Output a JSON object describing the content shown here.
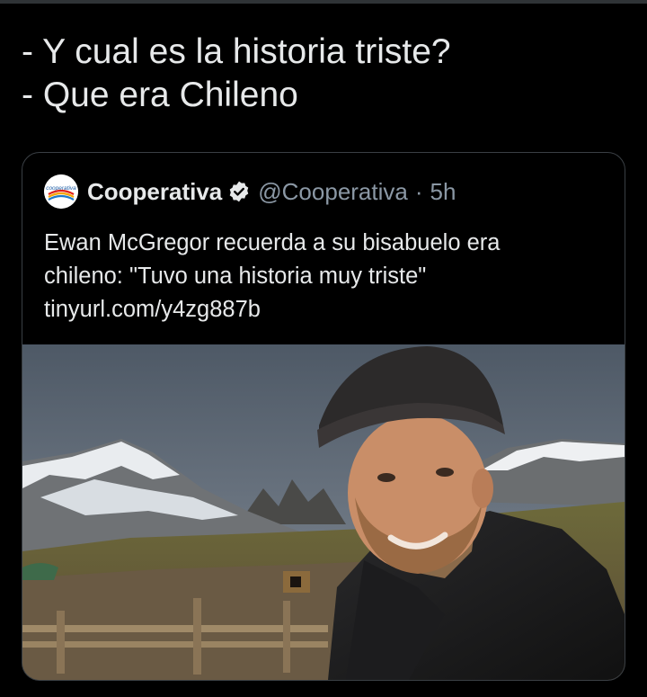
{
  "tweet": {
    "line1": "- Y cual es la historia triste?",
    "line2": "- Que era Chileno"
  },
  "quote": {
    "avatar_text": "cooperativa",
    "display_name": "Cooperativa",
    "verified_icon": "verified-badge-icon",
    "handle": "@Cooperativa",
    "separator": "·",
    "time": "5h",
    "text_line1": "Ewan McGregor recuerda a su bisabuelo era",
    "text_line2": "chileno: \"Tuvo una historia muy triste\"",
    "link": "tinyurl.com/y4zg887b"
  },
  "colors": {
    "background": "#000000",
    "text": "#e7e9ea",
    "muted": "#8b98a5",
    "border": "#3a3f44"
  }
}
